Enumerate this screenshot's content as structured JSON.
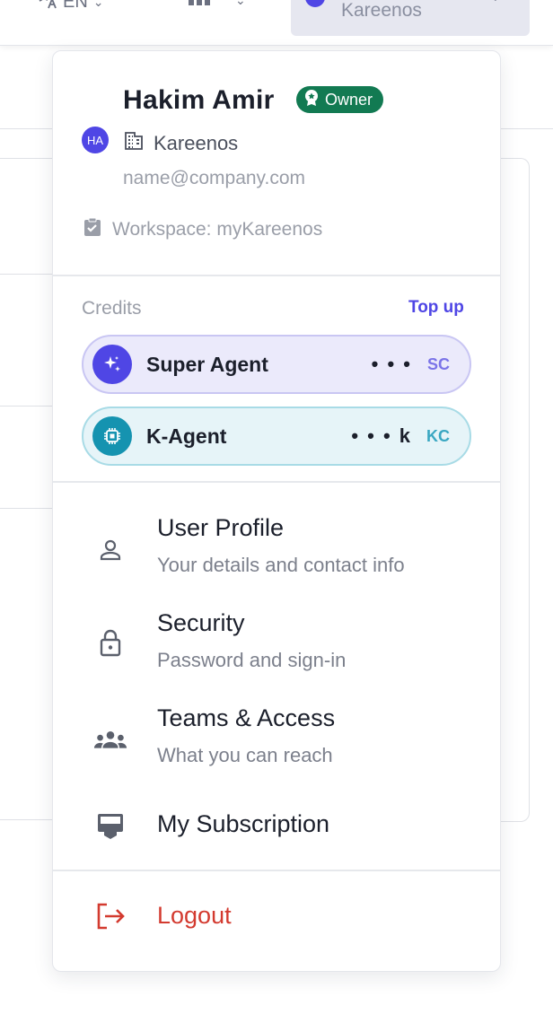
{
  "topbar": {
    "language": "EN",
    "tenant_name": "Kareenos"
  },
  "user": {
    "name": "Hakim Amir",
    "role_badge": "Owner",
    "avatar_initials": "HA",
    "organization": "Kareenos",
    "email": "name@company.com",
    "workspace": "Workspace: myKareenos"
  },
  "credits": {
    "label": "Credits",
    "topup_label": "Top up",
    "items": [
      {
        "name": "Super Agent",
        "value": "• • •",
        "code": "SC",
        "icon": "sparkle-icon"
      },
      {
        "name": "K-Agent",
        "value": "• • • k",
        "code": "KC",
        "icon": "chip-icon"
      }
    ]
  },
  "menu": {
    "items": [
      {
        "title": "User Profile",
        "subtitle": "Your details and contact info",
        "icon": "person-icon"
      },
      {
        "title": "Security",
        "subtitle": "Password and sign-in",
        "icon": "lock-icon"
      },
      {
        "title": "Teams & Access",
        "subtitle": "What you can reach",
        "icon": "group-icon"
      },
      {
        "title": "My Subscription",
        "icon": "card-icon"
      }
    ],
    "logout_label": "Logout"
  },
  "colors": {
    "accent": "#4f46e5",
    "owner_badge": "#127a52",
    "kagent": "#1593b0",
    "logout": "#d33a2f"
  }
}
